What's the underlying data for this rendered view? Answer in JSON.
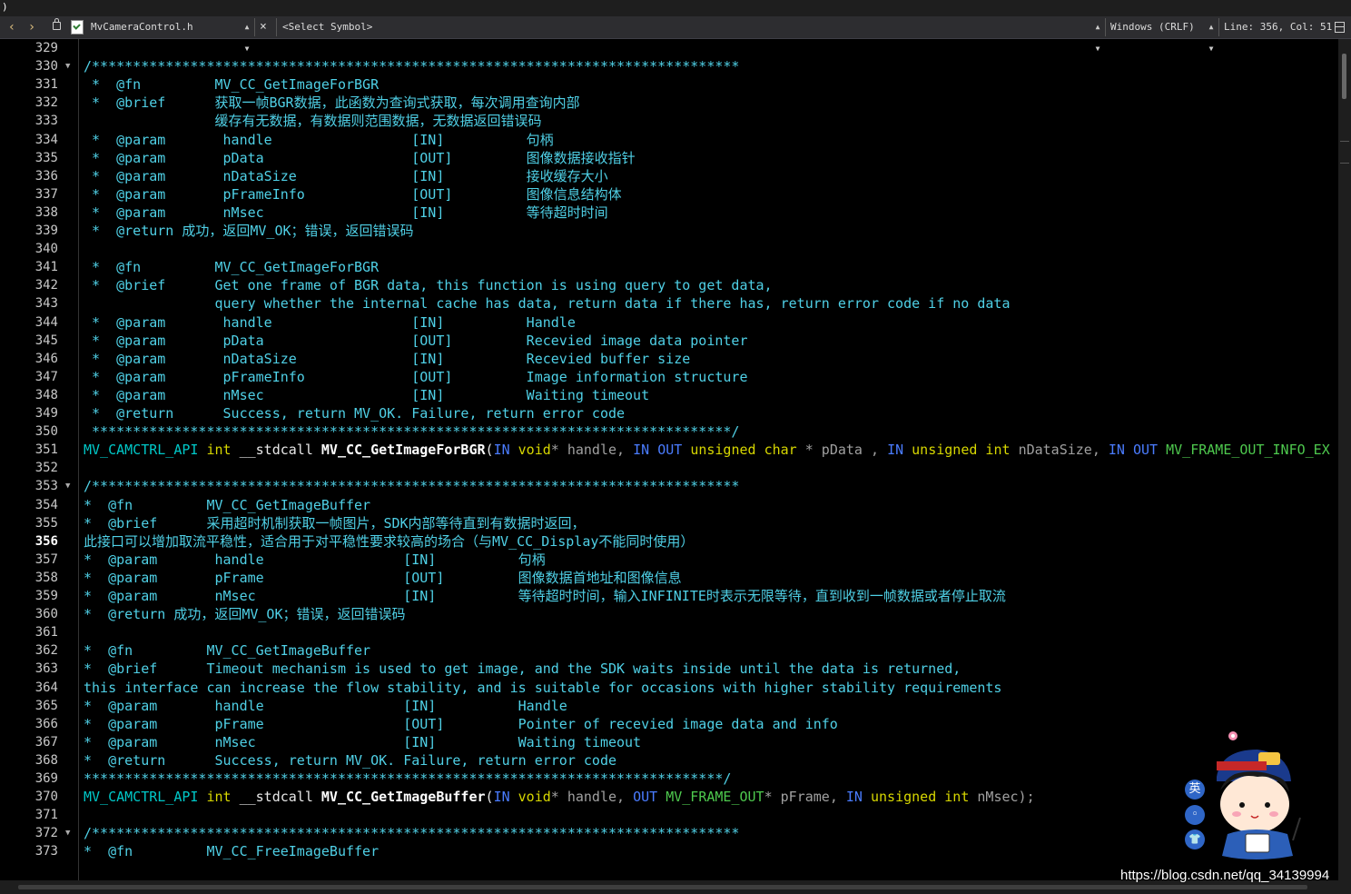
{
  "titlebar": {
    "text": ")"
  },
  "navbar": {
    "back_glyph": "‹",
    "forward_glyph": "›",
    "file_name": "MvCameraControl.h",
    "close_glyph": "×",
    "symbol": "<Select Symbol>",
    "line_ending": "Windows (CRLF)",
    "position": "Line: 356, Col: 51"
  },
  "watermark": "https://blog.csdn.net/qq_34139994",
  "ime": {
    "lang": "英",
    "punct": "◦",
    "shirt": "👕"
  },
  "lines": [
    {
      "n": "329",
      "parts": []
    },
    {
      "n": "330",
      "fold": true,
      "parts": [
        {
          "t": "/*******************************************************************************",
          "c": "c"
        }
      ]
    },
    {
      "n": "331",
      "parts": [
        {
          "t": " *  @fn         MV_CC_GetImageForBGR",
          "c": "c"
        }
      ]
    },
    {
      "n": "332",
      "parts": [
        {
          "t": " *  @brief      获取一帧BGR数据，此函数为查询式获取，每次调用查询内部",
          "c": "c"
        }
      ]
    },
    {
      "n": "333",
      "parts": [
        {
          "t": "                缓存有无数据，有数据则范围数据，无数据返回错误码",
          "c": "c"
        }
      ]
    },
    {
      "n": "334",
      "parts": [
        {
          "t": " *  @param       handle                 [IN]          句柄",
          "c": "c"
        }
      ]
    },
    {
      "n": "335",
      "parts": [
        {
          "t": " *  @param       pData                  [OUT]         图像数据接收指针",
          "c": "c"
        }
      ]
    },
    {
      "n": "336",
      "parts": [
        {
          "t": " *  @param       nDataSize              [IN]          接收缓存大小",
          "c": "c"
        }
      ]
    },
    {
      "n": "337",
      "parts": [
        {
          "t": " *  @param       pFrameInfo             [OUT]         图像信息结构体",
          "c": "c"
        }
      ]
    },
    {
      "n": "338",
      "parts": [
        {
          "t": " *  @param       nMsec                  [IN]          等待超时时间",
          "c": "c"
        }
      ]
    },
    {
      "n": "339",
      "parts": [
        {
          "t": " *  @return 成功，返回MV_OK；错误，返回错误码",
          "c": "c"
        }
      ]
    },
    {
      "n": "340",
      "parts": []
    },
    {
      "n": "341",
      "parts": [
        {
          "t": " *  @fn         MV_CC_GetImageForBGR",
          "c": "c"
        }
      ]
    },
    {
      "n": "342",
      "parts": [
        {
          "t": " *  @brief      Get one frame of BGR data, this function is using query to get data,",
          "c": "c"
        }
      ]
    },
    {
      "n": "343",
      "parts": [
        {
          "t": "                query whether the internal cache has data, return data if there has, return error code if no data",
          "c": "c"
        }
      ]
    },
    {
      "n": "344",
      "parts": [
        {
          "t": " *  @param       handle                 [IN]          Handle",
          "c": "c"
        }
      ]
    },
    {
      "n": "345",
      "parts": [
        {
          "t": " *  @param       pData                  [OUT]         Recevied image data pointer",
          "c": "c"
        }
      ]
    },
    {
      "n": "346",
      "parts": [
        {
          "t": " *  @param       nDataSize              [IN]          Recevied buffer size",
          "c": "c"
        }
      ]
    },
    {
      "n": "347",
      "parts": [
        {
          "t": " *  @param       pFrameInfo             [OUT]         Image information structure",
          "c": "c"
        }
      ]
    },
    {
      "n": "348",
      "parts": [
        {
          "t": " *  @param       nMsec                  [IN]          Waiting timeout",
          "c": "c"
        }
      ]
    },
    {
      "n": "349",
      "parts": [
        {
          "t": " *  @return      Success, return MV_OK. Failure, return error code",
          "c": "c"
        }
      ]
    },
    {
      "n": "350",
      "parts": [
        {
          "t": " ******************************************************************************/",
          "c": "c"
        }
      ]
    },
    {
      "n": "351",
      "parts": [
        {
          "t": "MV_CAMCTRL_API ",
          "c": "mac"
        },
        {
          "t": "int ",
          "c": "kw"
        },
        {
          "t": "__stdcall ",
          "c": "white"
        },
        {
          "t": "MV_CC_GetImageForBGR",
          "c": "fn"
        },
        {
          "t": "(",
          "c": "white"
        },
        {
          "t": "IN ",
          "c": "blue"
        },
        {
          "t": "void",
          "c": "kw"
        },
        {
          "t": "* handle, ",
          "c": "param"
        },
        {
          "t": "IN ",
          "c": "blue"
        },
        {
          "t": "OUT ",
          "c": "blue"
        },
        {
          "t": "unsigned char ",
          "c": "kw"
        },
        {
          "t": "* pData , ",
          "c": "param"
        },
        {
          "t": "IN ",
          "c": "blue"
        },
        {
          "t": "unsigned int ",
          "c": "kw"
        },
        {
          "t": "nDataSize, ",
          "c": "param"
        },
        {
          "t": "IN ",
          "c": "blue"
        },
        {
          "t": "OUT ",
          "c": "blue"
        },
        {
          "t": "MV_FRAME_OUT_INFO_EX",
          "c": "green"
        }
      ]
    },
    {
      "n": "352",
      "parts": []
    },
    {
      "n": "353",
      "fold": true,
      "parts": [
        {
          "t": "/*******************************************************************************",
          "c": "c"
        }
      ]
    },
    {
      "n": "354",
      "parts": [
        {
          "t": "*  @fn         MV_CC_GetImageBuffer",
          "c": "c"
        }
      ]
    },
    {
      "n": "355",
      "parts": [
        {
          "t": "*  @brief      采用超时机制获取一帧图片，SDK内部等待直到有数据时返回，",
          "c": "c"
        }
      ]
    },
    {
      "n": "356",
      "cur": true,
      "parts": [
        {
          "t": "此接口可以增加取流平稳性，适合用于对平稳性要求较高的场合（与MV_CC_Display不能同时使用）",
          "c": "c"
        }
      ]
    },
    {
      "n": "357",
      "parts": [
        {
          "t": "*  @param       handle                 [IN]          句柄",
          "c": "c"
        }
      ]
    },
    {
      "n": "358",
      "parts": [
        {
          "t": "*  @param       pFrame                 [OUT]         图像数据首地址和图像信息",
          "c": "c"
        }
      ]
    },
    {
      "n": "359",
      "parts": [
        {
          "t": "*  @param       nMsec                  [IN]          等待超时时间，输入INFINITE时表示无限等待，直到收到一帧数据或者停止取流",
          "c": "c"
        }
      ]
    },
    {
      "n": "360",
      "parts": [
        {
          "t": "*  @return 成功，返回MV_OK；错误，返回错误码",
          "c": "c"
        }
      ]
    },
    {
      "n": "361",
      "parts": []
    },
    {
      "n": "362",
      "parts": [
        {
          "t": "*  @fn         MV_CC_GetImageBuffer",
          "c": "c"
        }
      ]
    },
    {
      "n": "363",
      "parts": [
        {
          "t": "*  @brief      Timeout mechanism is used to get image, and the SDK waits inside until the data is returned,",
          "c": "c"
        }
      ]
    },
    {
      "n": "364",
      "parts": [
        {
          "t": "this interface can increase the flow stability, and is suitable for occasions with higher stability requirements",
          "c": "c"
        }
      ]
    },
    {
      "n": "365",
      "parts": [
        {
          "t": "*  @param       handle                 [IN]          Handle",
          "c": "c"
        }
      ]
    },
    {
      "n": "366",
      "parts": [
        {
          "t": "*  @param       pFrame                 [OUT]         Pointer of recevied image data and info",
          "c": "c"
        }
      ]
    },
    {
      "n": "367",
      "parts": [
        {
          "t": "*  @param       nMsec                  [IN]          Waiting timeout",
          "c": "c"
        }
      ]
    },
    {
      "n": "368",
      "parts": [
        {
          "t": "*  @return      Success, return MV_OK. Failure, return error code",
          "c": "c"
        }
      ]
    },
    {
      "n": "369",
      "parts": [
        {
          "t": "******************************************************************************/",
          "c": "c"
        }
      ]
    },
    {
      "n": "370",
      "parts": [
        {
          "t": "MV_CAMCTRL_API ",
          "c": "mac"
        },
        {
          "t": "int ",
          "c": "kw"
        },
        {
          "t": "__stdcall ",
          "c": "white"
        },
        {
          "t": "MV_CC_GetImageBuffer",
          "c": "fn"
        },
        {
          "t": "(",
          "c": "white"
        },
        {
          "t": "IN ",
          "c": "blue"
        },
        {
          "t": "void",
          "c": "kw"
        },
        {
          "t": "* handle, ",
          "c": "param"
        },
        {
          "t": "OUT ",
          "c": "blue"
        },
        {
          "t": "MV_FRAME_OUT",
          "c": "green"
        },
        {
          "t": "* pFrame, ",
          "c": "param"
        },
        {
          "t": "IN ",
          "c": "blue"
        },
        {
          "t": "unsigned int ",
          "c": "kw"
        },
        {
          "t": "nMsec);",
          "c": "param"
        }
      ]
    },
    {
      "n": "371",
      "parts": []
    },
    {
      "n": "372",
      "fold": true,
      "parts": [
        {
          "t": "/*******************************************************************************",
          "c": "c"
        }
      ]
    },
    {
      "n": "373",
      "parts": [
        {
          "t": "*  @fn         MV_CC_FreeImageBuffer",
          "c": "c"
        }
      ]
    }
  ]
}
